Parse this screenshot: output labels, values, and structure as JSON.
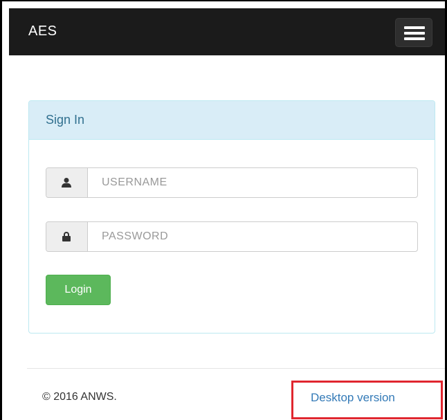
{
  "navbar": {
    "brand": "AES",
    "menu_icon": "hamburger-menu-icon"
  },
  "signin": {
    "title": "Sign In",
    "username": {
      "icon": "user-icon",
      "placeholder": "USERNAME",
      "value": ""
    },
    "password": {
      "icon": "lock-icon",
      "placeholder": "PASSWORD",
      "value": ""
    },
    "login_label": "Login"
  },
  "footer": {
    "copyright": "© 2016 ANWS.",
    "desktop_link": "Desktop version"
  },
  "colors": {
    "navbar_bg": "#1b1b1b",
    "panel_heading_bg": "#d9edf7",
    "panel_title": "#31708f",
    "login_button": "#5cb85c",
    "link": "#337ab7",
    "highlight_box": "#e0262f"
  }
}
